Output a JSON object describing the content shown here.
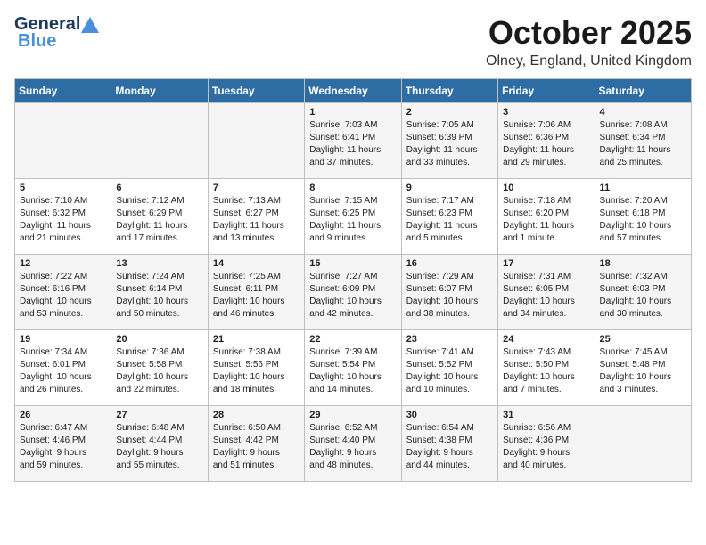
{
  "header": {
    "logo_line1": "General",
    "logo_line2": "Blue",
    "month_title": "October 2025",
    "location": "Olney, England, United Kingdom"
  },
  "weekdays": [
    "Sunday",
    "Monday",
    "Tuesday",
    "Wednesday",
    "Thursday",
    "Friday",
    "Saturday"
  ],
  "weeks": [
    [
      {
        "day": "",
        "info": ""
      },
      {
        "day": "",
        "info": ""
      },
      {
        "day": "",
        "info": ""
      },
      {
        "day": "1",
        "info": "Sunrise: 7:03 AM\nSunset: 6:41 PM\nDaylight: 11 hours\nand 37 minutes."
      },
      {
        "day": "2",
        "info": "Sunrise: 7:05 AM\nSunset: 6:39 PM\nDaylight: 11 hours\nand 33 minutes."
      },
      {
        "day": "3",
        "info": "Sunrise: 7:06 AM\nSunset: 6:36 PM\nDaylight: 11 hours\nand 29 minutes."
      },
      {
        "day": "4",
        "info": "Sunrise: 7:08 AM\nSunset: 6:34 PM\nDaylight: 11 hours\nand 25 minutes."
      }
    ],
    [
      {
        "day": "5",
        "info": "Sunrise: 7:10 AM\nSunset: 6:32 PM\nDaylight: 11 hours\nand 21 minutes."
      },
      {
        "day": "6",
        "info": "Sunrise: 7:12 AM\nSunset: 6:29 PM\nDaylight: 11 hours\nand 17 minutes."
      },
      {
        "day": "7",
        "info": "Sunrise: 7:13 AM\nSunset: 6:27 PM\nDaylight: 11 hours\nand 13 minutes."
      },
      {
        "day": "8",
        "info": "Sunrise: 7:15 AM\nSunset: 6:25 PM\nDaylight: 11 hours\nand 9 minutes."
      },
      {
        "day": "9",
        "info": "Sunrise: 7:17 AM\nSunset: 6:23 PM\nDaylight: 11 hours\nand 5 minutes."
      },
      {
        "day": "10",
        "info": "Sunrise: 7:18 AM\nSunset: 6:20 PM\nDaylight: 11 hours\nand 1 minute."
      },
      {
        "day": "11",
        "info": "Sunrise: 7:20 AM\nSunset: 6:18 PM\nDaylight: 10 hours\nand 57 minutes."
      }
    ],
    [
      {
        "day": "12",
        "info": "Sunrise: 7:22 AM\nSunset: 6:16 PM\nDaylight: 10 hours\nand 53 minutes."
      },
      {
        "day": "13",
        "info": "Sunrise: 7:24 AM\nSunset: 6:14 PM\nDaylight: 10 hours\nand 50 minutes."
      },
      {
        "day": "14",
        "info": "Sunrise: 7:25 AM\nSunset: 6:11 PM\nDaylight: 10 hours\nand 46 minutes."
      },
      {
        "day": "15",
        "info": "Sunrise: 7:27 AM\nSunset: 6:09 PM\nDaylight: 10 hours\nand 42 minutes."
      },
      {
        "day": "16",
        "info": "Sunrise: 7:29 AM\nSunset: 6:07 PM\nDaylight: 10 hours\nand 38 minutes."
      },
      {
        "day": "17",
        "info": "Sunrise: 7:31 AM\nSunset: 6:05 PM\nDaylight: 10 hours\nand 34 minutes."
      },
      {
        "day": "18",
        "info": "Sunrise: 7:32 AM\nSunset: 6:03 PM\nDaylight: 10 hours\nand 30 minutes."
      }
    ],
    [
      {
        "day": "19",
        "info": "Sunrise: 7:34 AM\nSunset: 6:01 PM\nDaylight: 10 hours\nand 26 minutes."
      },
      {
        "day": "20",
        "info": "Sunrise: 7:36 AM\nSunset: 5:58 PM\nDaylight: 10 hours\nand 22 minutes."
      },
      {
        "day": "21",
        "info": "Sunrise: 7:38 AM\nSunset: 5:56 PM\nDaylight: 10 hours\nand 18 minutes."
      },
      {
        "day": "22",
        "info": "Sunrise: 7:39 AM\nSunset: 5:54 PM\nDaylight: 10 hours\nand 14 minutes."
      },
      {
        "day": "23",
        "info": "Sunrise: 7:41 AM\nSunset: 5:52 PM\nDaylight: 10 hours\nand 10 minutes."
      },
      {
        "day": "24",
        "info": "Sunrise: 7:43 AM\nSunset: 5:50 PM\nDaylight: 10 hours\nand 7 minutes."
      },
      {
        "day": "25",
        "info": "Sunrise: 7:45 AM\nSunset: 5:48 PM\nDaylight: 10 hours\nand 3 minutes."
      }
    ],
    [
      {
        "day": "26",
        "info": "Sunrise: 6:47 AM\nSunset: 4:46 PM\nDaylight: 9 hours\nand 59 minutes."
      },
      {
        "day": "27",
        "info": "Sunrise: 6:48 AM\nSunset: 4:44 PM\nDaylight: 9 hours\nand 55 minutes."
      },
      {
        "day": "28",
        "info": "Sunrise: 6:50 AM\nSunset: 4:42 PM\nDaylight: 9 hours\nand 51 minutes."
      },
      {
        "day": "29",
        "info": "Sunrise: 6:52 AM\nSunset: 4:40 PM\nDaylight: 9 hours\nand 48 minutes."
      },
      {
        "day": "30",
        "info": "Sunrise: 6:54 AM\nSunset: 4:38 PM\nDaylight: 9 hours\nand 44 minutes."
      },
      {
        "day": "31",
        "info": "Sunrise: 6:56 AM\nSunset: 4:36 PM\nDaylight: 9 hours\nand 40 minutes."
      },
      {
        "day": "",
        "info": ""
      }
    ]
  ]
}
